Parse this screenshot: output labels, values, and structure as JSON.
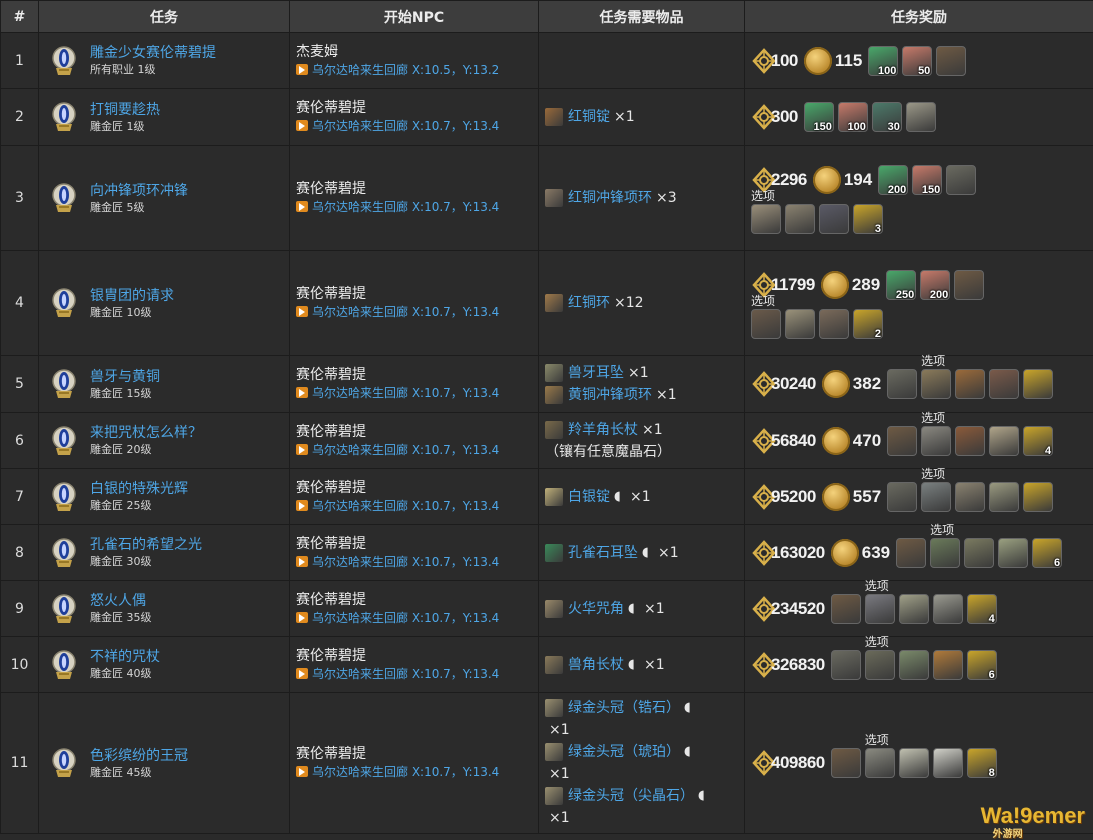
{
  "headers": {
    "num": "#",
    "quest": "任务",
    "npc": "开始NPC",
    "items": "任务需要物品",
    "rewards": "任务奖励"
  },
  "option_label": "选项",
  "watermark": {
    "main": "Wa!9emer",
    "sub": "外游网"
  },
  "colors": {
    "link": "#4ea6e6",
    "marker": "#e08a1e",
    "background": "#2b2b2b",
    "header": "#3d3d3d"
  },
  "rows": [
    {
      "num": "1",
      "name": "雕金少女赛伦蒂碧提",
      "level": "所有职业 1级",
      "npc": "杰麦姆",
      "loc": "乌尔达哈来生回廊 X:10.5，Y:13.2",
      "items": [],
      "xp": "100",
      "gil": "115",
      "rewards": [
        {
          "c": "#49a86a",
          "n": "100"
        },
        {
          "c": "#c77a6a",
          "n": "50"
        },
        {
          "c": "#6e5a44",
          "n": ""
        }
      ],
      "options": []
    },
    {
      "num": "2",
      "name": "打铜要趁热",
      "level": "雕金匠 1级",
      "npc": "赛伦蒂碧提",
      "loc": "乌尔达哈来生回廊 X:10.7，Y:13.4",
      "items": [
        {
          "name": "红铜锭",
          "qty": "×1",
          "hq": false,
          "c": "#9a6a3a"
        }
      ],
      "xp": "300",
      "gil": "",
      "rewards": [
        {
          "c": "#49a86a",
          "n": "150"
        },
        {
          "c": "#c77a6a",
          "n": "100"
        },
        {
          "c": "#4c7a6a",
          "n": "30"
        },
        {
          "c": "#9b9888",
          "n": ""
        }
      ],
      "options": []
    },
    {
      "num": "3",
      "name": "向冲锋项环冲锋",
      "level": "雕金匠 5级",
      "npc": "赛伦蒂碧提",
      "loc": "乌尔达哈来生回廊 X:10.7，Y:13.4",
      "items": [
        {
          "name": "红铜冲锋项环",
          "qty": "×3",
          "hq": false,
          "c": "#8a7a66"
        }
      ],
      "xp": "2296",
      "gil": "194",
      "rewards": [
        {
          "c": "#49a86a",
          "n": "200"
        },
        {
          "c": "#c77a6a",
          "n": "150"
        },
        {
          "c": "#6a6a60",
          "n": ""
        }
      ],
      "options": [
        {
          "c": "#9a8f7a",
          "n": ""
        },
        {
          "c": "#8a8270",
          "n": ""
        },
        {
          "c": "#5a5a66",
          "n": ""
        },
        {
          "c": "#c9a52a",
          "n": "3"
        }
      ]
    },
    {
      "num": "4",
      "name": "银胄团的请求",
      "level": "雕金匠 10级",
      "npc": "赛伦蒂碧提",
      "loc": "乌尔达哈来生回廊 X:10.7，Y:13.4",
      "items": [
        {
          "name": "红铜环",
          "qty": "×12",
          "hq": false,
          "c": "#a07a4a"
        }
      ],
      "xp": "11799",
      "gil": "289",
      "rewards": [
        {
          "c": "#49a86a",
          "n": "250"
        },
        {
          "c": "#c77a6a",
          "n": "200"
        },
        {
          "c": "#6e5a44",
          "n": ""
        }
      ],
      "options": [
        {
          "c": "#6a5a4a",
          "n": ""
        },
        {
          "c": "#9a927a",
          "n": ""
        },
        {
          "c": "#7a6a5a",
          "n": ""
        },
        {
          "c": "#c9a52a",
          "n": "2"
        }
      ]
    },
    {
      "num": "5",
      "name": "兽牙与黄铜",
      "level": "雕金匠 15级",
      "npc": "赛伦蒂碧提",
      "loc": "乌尔达哈来生回廊 X:10.7，Y:13.4",
      "items": [
        {
          "name": "兽牙耳坠",
          "qty": "×1",
          "hq": false,
          "c": "#8a8a6a"
        },
        {
          "name": "黄铜冲锋项环",
          "qty": "×1",
          "hq": false,
          "c": "#9a7a4a"
        }
      ],
      "xp": "30240",
      "gil": "382",
      "rewards": [
        {
          "c": "#6a6a60",
          "n": ""
        }
      ],
      "options": [
        {
          "c": "#8a7a5a",
          "n": ""
        },
        {
          "c": "#9a6a3a",
          "n": ""
        },
        {
          "c": "#7a5a4a",
          "n": ""
        },
        {
          "c": "#c9a52a",
          "n": ""
        }
      ]
    },
    {
      "num": "6",
      "name": "来把咒杖怎么样？",
      "level": "雕金匠 20级",
      "npc": "赛伦蒂碧提",
      "loc": "乌尔达哈来生回廊 X:10.7，Y:13.4",
      "items": [
        {
          "name": "羚羊角长杖",
          "qty": "×1",
          "hq": false,
          "c": "#7a6a4a",
          "note": "（镶有任意魔晶石）"
        }
      ],
      "xp": "56840",
      "gil": "470",
      "rewards": [
        {
          "c": "#6e5a44",
          "n": ""
        }
      ],
      "options": [
        {
          "c": "#8a8880",
          "n": ""
        },
        {
          "c": "#8a5a3a",
          "n": ""
        },
        {
          "c": "#b0a58a",
          "n": ""
        },
        {
          "c": "#c9a52a",
          "n": "4"
        }
      ]
    },
    {
      "num": "7",
      "name": "白银的特殊光辉",
      "level": "雕金匠 25级",
      "npc": "赛伦蒂碧提",
      "loc": "乌尔达哈来生回廊 X:10.7，Y:13.4",
      "items": [
        {
          "name": "白银锭",
          "qty": "×1",
          "hq": true,
          "c": "#c0b07a"
        }
      ],
      "xp": "95200",
      "gil": "557",
      "rewards": [
        {
          "c": "#6a6a60",
          "n": ""
        }
      ],
      "options": [
        {
          "c": "#7a8080",
          "n": ""
        },
        {
          "c": "#8a8270",
          "n": ""
        },
        {
          "c": "#9a9a80",
          "n": ""
        },
        {
          "c": "#c9a52a",
          "n": ""
        }
      ]
    },
    {
      "num": "8",
      "name": "孔雀石的希望之光",
      "level": "雕金匠 30级",
      "npc": "赛伦蒂碧提",
      "loc": "乌尔达哈来生回廊 X:10.7，Y:13.4",
      "items": [
        {
          "name": "孔雀石耳坠",
          "qty": "×1",
          "hq": true,
          "c": "#3a8a5a"
        }
      ],
      "xp": "163020",
      "gil": "639",
      "rewards": [
        {
          "c": "#6e5a44",
          "n": ""
        }
      ],
      "options": [
        {
          "c": "#6a7a5a",
          "n": ""
        },
        {
          "c": "#7a7a60",
          "n": ""
        },
        {
          "c": "#9aa080",
          "n": ""
        },
        {
          "c": "#c9a52a",
          "n": "6"
        }
      ]
    },
    {
      "num": "9",
      "name": "怒火人偶",
      "level": "雕金匠 35级",
      "npc": "赛伦蒂碧提",
      "loc": "乌尔达哈来生回廊 X:10.7，Y:13.4",
      "items": [
        {
          "name": "火华咒角",
          "qty": "×1",
          "hq": true,
          "c": "#9a8a6a"
        }
      ],
      "xp": "234520",
      "gil": "",
      "rewards": [
        {
          "c": "#6e5a44",
          "n": ""
        }
      ],
      "options": [
        {
          "c": "#7a7a80",
          "n": ""
        },
        {
          "c": "#a0a088",
          "n": ""
        },
        {
          "c": "#9a9a90",
          "n": ""
        },
        {
          "c": "#c9a52a",
          "n": "4"
        }
      ]
    },
    {
      "num": "10",
      "name": "不祥的咒杖",
      "level": "雕金匠 40级",
      "npc": "赛伦蒂碧提",
      "loc": "乌尔达哈来生回廊 X:10.7，Y:13.4",
      "items": [
        {
          "name": "兽角长杖",
          "qty": "×1",
          "hq": true,
          "c": "#8a7a5a"
        }
      ],
      "xp": "326830",
      "gil": "",
      "rewards": [
        {
          "c": "#6a6a60",
          "n": ""
        }
      ],
      "options": [
        {
          "c": "#6a6a5a",
          "n": ""
        },
        {
          "c": "#7a8a6a",
          "n": ""
        },
        {
          "c": "#b07a3a",
          "n": ""
        },
        {
          "c": "#c9a52a",
          "n": "6"
        }
      ]
    },
    {
      "num": "11",
      "name": "色彩缤纷的王冠",
      "level": "雕金匠 45级",
      "npc": "赛伦蒂碧提",
      "loc": "乌尔达哈来生回廊 X:10.7，Y:13.4",
      "items": [
        {
          "name": "绿金头冠（锆石）",
          "qty": "×1",
          "hq": true,
          "c": "#9a9070",
          "wrap": true
        },
        {
          "name": "绿金头冠（琥珀）",
          "qty": "×1",
          "hq": true,
          "c": "#9a9070",
          "wrap": true
        },
        {
          "name": "绿金头冠（尖晶石）",
          "qty": "×1",
          "hq": true,
          "c": "#9a9070",
          "wrap": true
        }
      ],
      "xp": "409860",
      "gil": "",
      "rewards": [
        {
          "c": "#6e5a44",
          "n": ""
        }
      ],
      "options": [
        {
          "c": "#8a8a80",
          "n": ""
        },
        {
          "c": "#c0c0b0",
          "n": ""
        },
        {
          "c": "#d0d0c8",
          "n": ""
        },
        {
          "c": "#c9a52a",
          "n": "8"
        }
      ]
    }
  ]
}
